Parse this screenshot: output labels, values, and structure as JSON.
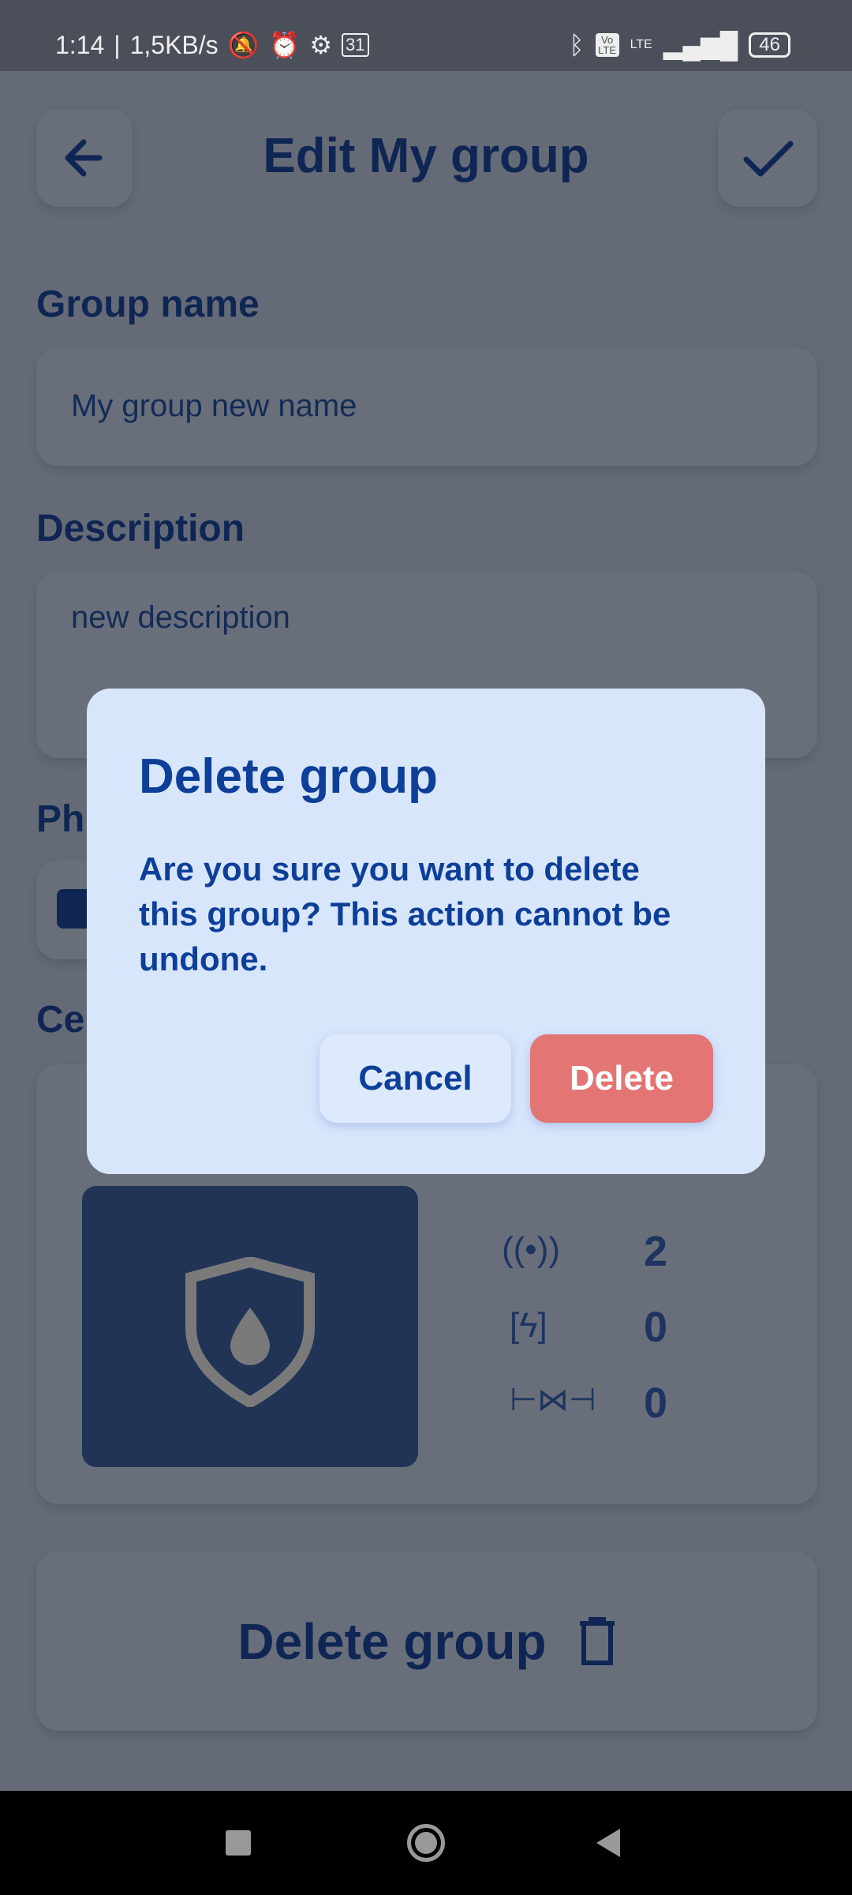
{
  "status": {
    "time": "1:14",
    "speed": "1,5KB/s",
    "calendar": "31",
    "volte": "Vo LTE",
    "network": "LTE",
    "battery": "46"
  },
  "header": {
    "title": "Edit My group"
  },
  "form": {
    "group_name_label": "Group name",
    "group_name_value": "My group new name",
    "description_label": "Description",
    "description_value": "new description",
    "photo_label": "Ph",
    "center_label": "Ce"
  },
  "stats": [
    {
      "icon": "sensor-icon",
      "value": "2"
    },
    {
      "icon": "battery-charging-icon",
      "value": "0"
    },
    {
      "icon": "valve-leak-icon",
      "value": "0"
    }
  ],
  "delete_group_label": "Delete group",
  "dialog": {
    "title": "Delete group",
    "body": "Are you sure you want to delete this group? This action cannot be undone.",
    "cancel": "Cancel",
    "delete": "Delete"
  }
}
